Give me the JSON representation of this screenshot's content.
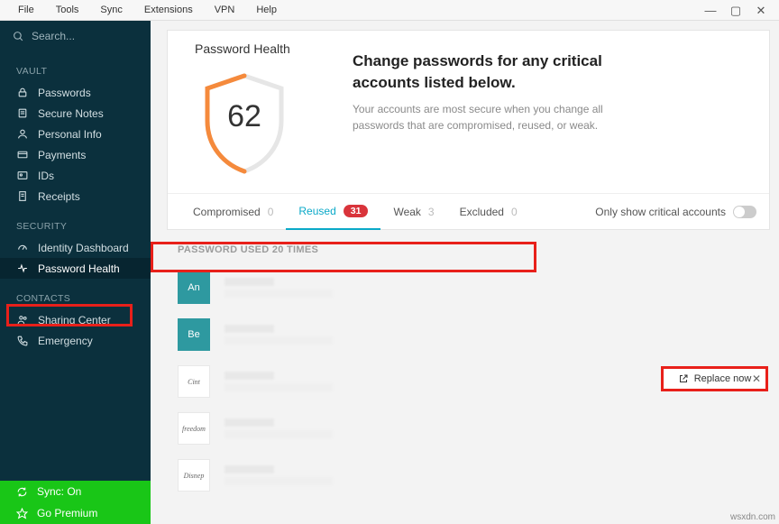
{
  "menubar": {
    "items": [
      "File",
      "Tools",
      "Sync",
      "Extensions",
      "VPN",
      "Help"
    ]
  },
  "search": {
    "placeholder": "Search..."
  },
  "sidebar": {
    "sections": [
      {
        "head": "VAULT",
        "items": [
          {
            "icon": "lock",
            "label": "Passwords"
          },
          {
            "icon": "note",
            "label": "Secure Notes"
          },
          {
            "icon": "person",
            "label": "Personal Info"
          },
          {
            "icon": "card",
            "label": "Payments"
          },
          {
            "icon": "id",
            "label": "IDs"
          },
          {
            "icon": "receipt",
            "label": "Receipts"
          }
        ]
      },
      {
        "head": "SECURITY",
        "items": [
          {
            "icon": "gauge",
            "label": "Identity Dashboard"
          },
          {
            "icon": "pulse",
            "label": "Password Health",
            "active": true
          }
        ]
      },
      {
        "head": "CONTACTS",
        "items": [
          {
            "icon": "people",
            "label": "Sharing Center"
          },
          {
            "icon": "phone",
            "label": "Emergency"
          }
        ]
      }
    ]
  },
  "footer": {
    "sync": "Sync: On",
    "premium": "Go Premium"
  },
  "card": {
    "title": "Password Health",
    "score": "62",
    "headline": "Change passwords for any critical accounts listed below.",
    "sub": "Your accounts are most secure when you change all passwords that are compromised, reused, or weak."
  },
  "tabs": {
    "items": [
      {
        "label": "Compromised",
        "count": "0"
      },
      {
        "label": "Reused",
        "count": "31",
        "pill": true,
        "active": true
      },
      {
        "label": "Weak",
        "count": "3"
      },
      {
        "label": "Excluded",
        "count": "0"
      }
    ],
    "toggle_label": "Only show critical accounts"
  },
  "list": {
    "head": "PASSWORD USED 20 TIMES",
    "rows": [
      {
        "logo": "An",
        "cls": "teal"
      },
      {
        "logo": "Be",
        "cls": "teal"
      },
      {
        "logo": "Cint",
        "cls": "white"
      },
      {
        "logo": "freedom",
        "cls": "white"
      },
      {
        "logo": "Disnep",
        "cls": "white"
      }
    ]
  },
  "replace": {
    "label": "Replace now"
  },
  "watermark": "wsxdn.com"
}
